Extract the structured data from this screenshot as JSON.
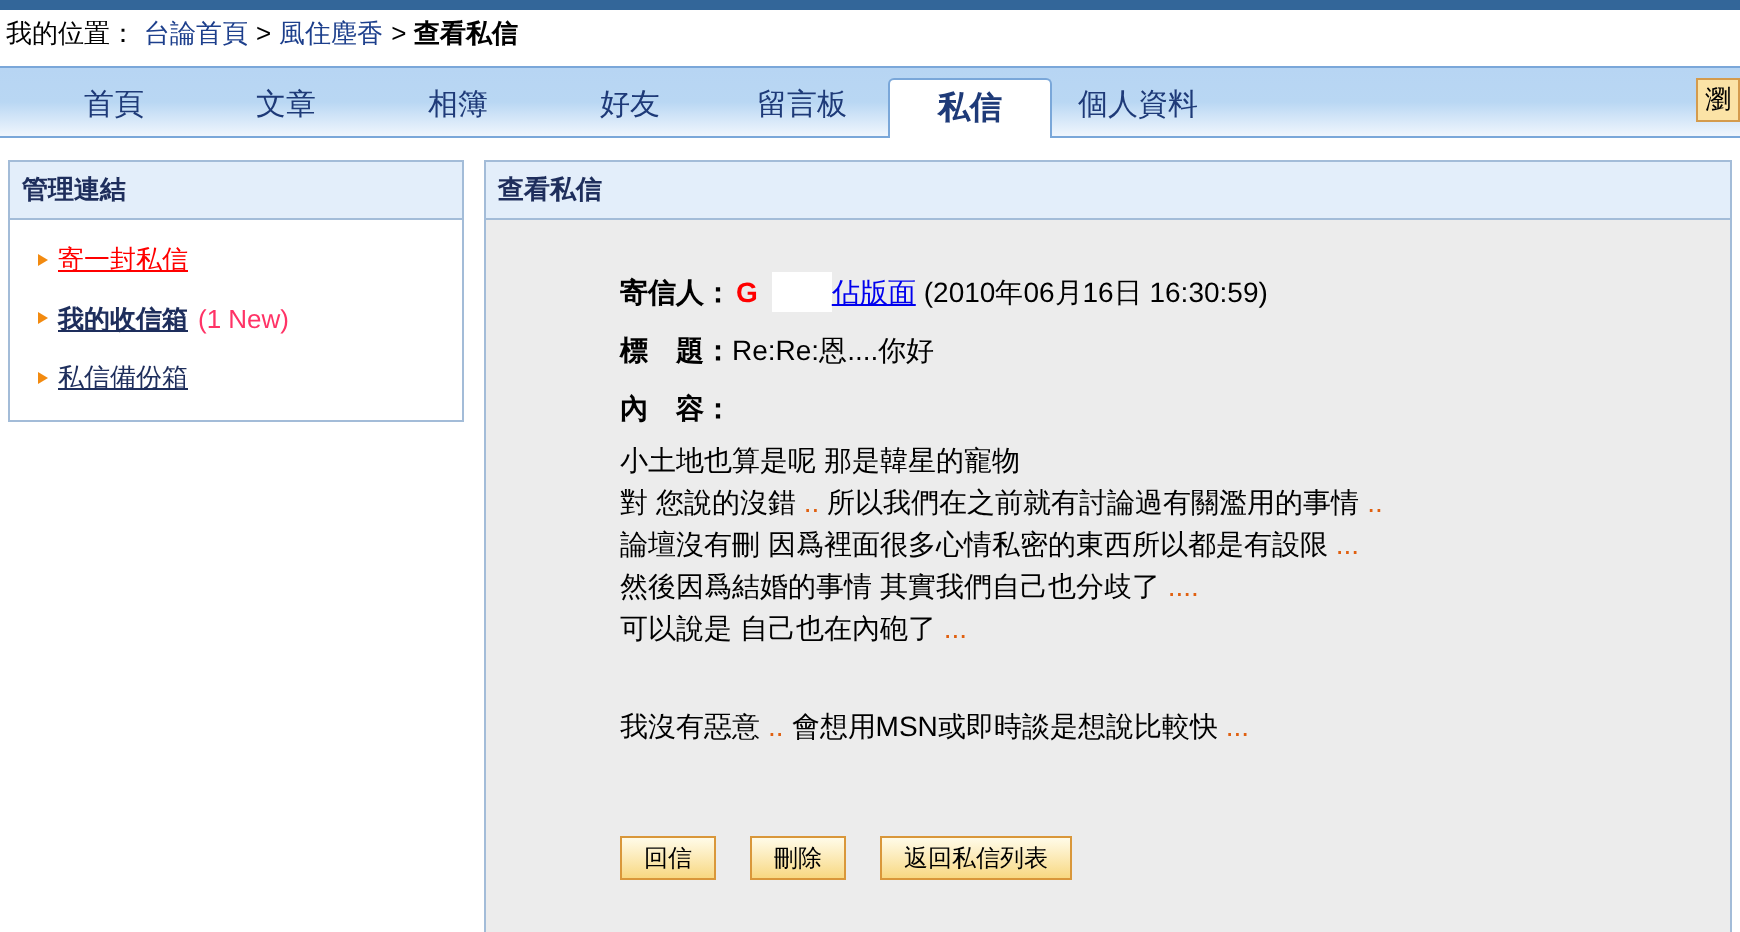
{
  "breadcrumb": {
    "label": "我的位置：",
    "links": [
      "台論首頁",
      "風住塵香"
    ],
    "separator": ">",
    "current": "查看私信"
  },
  "tabs": [
    {
      "label": "首頁",
      "selected": false
    },
    {
      "label": "文章",
      "selected": false
    },
    {
      "label": "相簿",
      "selected": false
    },
    {
      "label": "好友",
      "selected": false
    },
    {
      "label": "留言板",
      "selected": false
    },
    {
      "label": "私信",
      "selected": true
    },
    {
      "label": "個人資料",
      "selected": false
    }
  ],
  "corner_button": "瀏",
  "sidebar": {
    "title": "管理連結",
    "items": [
      {
        "label": "寄一封私信",
        "kind": "red"
      },
      {
        "label": "我的收信箱",
        "kind": "bold",
        "badge": "(1 New)"
      },
      {
        "label": "私信備份箱",
        "kind": "plain"
      }
    ]
  },
  "message": {
    "title": "查看私信",
    "sender_label": "寄信人：",
    "sender_initial": "G",
    "sender_link": "佔版面",
    "date": "(2010年06月16日 16:30:59)",
    "subject_label": "標　題：",
    "subject": "Re:Re:恩....你好",
    "content_label": "內　容：",
    "lines": [
      {
        "text": "小土地也算是呢 那是韓星的寵物"
      },
      {
        "text": "對 您說的沒錯",
        "dots": "..",
        "rest": "所以我們在之前就有討論過有關濫用的事情",
        "end": ".."
      },
      {
        "text": "論壇沒有刪 因爲裡面很多心情私密的東西所以都是有設限",
        "dots": "..."
      },
      {
        "text": "然後因爲結婚的事情 其實我們自己也分歧了",
        "dots": "...."
      },
      {
        "text": "可以說是 自己也在內砲了",
        "dots": "..."
      },
      {
        "kind": "gap"
      },
      {
        "text": "我沒有惡意",
        "dots": "..",
        "rest": "會想用MSN或即時談是想說比較快",
        "end": "..."
      }
    ],
    "buttons": [
      "回信",
      "刪除",
      "返回私信列表"
    ]
  }
}
